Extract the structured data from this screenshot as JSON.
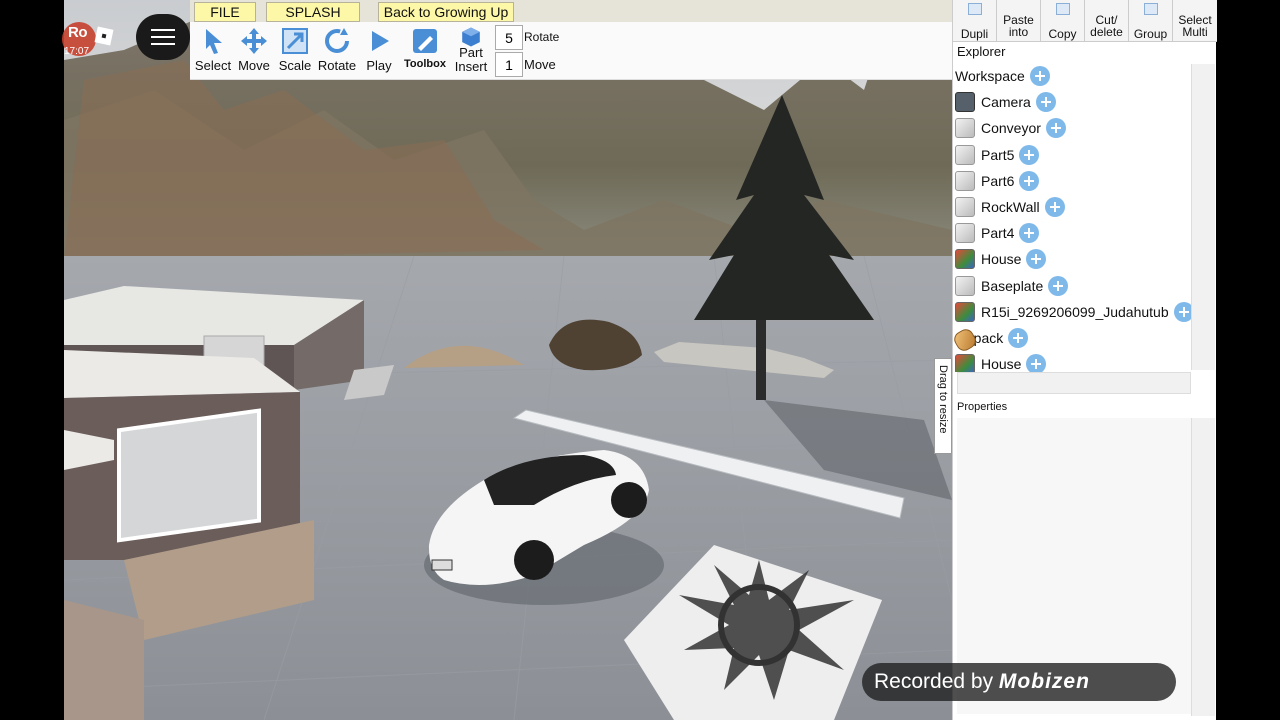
{
  "status_clock": "17:07",
  "toolbar": {
    "tabs": [
      "FILE",
      "SPLASH",
      "Back to Growing Up"
    ],
    "tools": [
      {
        "label": "Select",
        "icon": "select-arrow-icon"
      },
      {
        "label": "Move",
        "icon": "move-arrows-icon"
      },
      {
        "label": "Scale",
        "icon": "scale-icon"
      },
      {
        "label": "Rotate",
        "icon": "rotate-icon"
      },
      {
        "label": "Play",
        "icon": "play-icon"
      },
      {
        "label": "Toolbox",
        "icon": "toolbox-icon"
      }
    ],
    "part_insert": {
      "line1": "Part",
      "line2": "Insert"
    },
    "rotate_step": "5",
    "rotate_label": "Rotate",
    "move_step": "1",
    "move_label": "Move"
  },
  "panel_tools": [
    {
      "label": "Dupli",
      "label2": ""
    },
    {
      "label": "Paste",
      "label2": "into"
    },
    {
      "label": "Copy",
      "label2": ""
    },
    {
      "label": "Cut/",
      "label2": "delete"
    },
    {
      "label": "Group",
      "label2": ""
    },
    {
      "label": "Select",
      "label2": "Multi"
    }
  ],
  "explorer": {
    "title": "Explorer",
    "items": [
      {
        "name": "Workspace",
        "icon": "none",
        "level": 0
      },
      {
        "name": "Camera",
        "icon": "camera",
        "level": 1
      },
      {
        "name": "Conveyor",
        "icon": "part",
        "level": 1
      },
      {
        "name": "Part5",
        "icon": "part",
        "level": 1
      },
      {
        "name": "Part6",
        "icon": "part",
        "level": 1
      },
      {
        "name": "RockWall",
        "icon": "part",
        "level": 1
      },
      {
        "name": "Part4",
        "icon": "part",
        "level": 1
      },
      {
        "name": "House",
        "icon": "model",
        "level": 1
      },
      {
        "name": "Baseplate",
        "icon": "part",
        "level": 1
      },
      {
        "name": "R15i_9269206099_Judahutub",
        "icon": "model",
        "level": 1
      },
      {
        "name": "Jetpack",
        "icon": "tool",
        "level": 1
      },
      {
        "name": "House",
        "icon": "model",
        "level": 1
      }
    ]
  },
  "properties": {
    "title": "Properties"
  },
  "resize_handle": "Drag to resize",
  "recorder": {
    "prefix": "Recorded by",
    "brand": "Mobizen"
  },
  "colors": {
    "tab_bg": "#fdf7a8",
    "plus_button": "#7fb9ea",
    "accent": "#4a8fd6"
  }
}
